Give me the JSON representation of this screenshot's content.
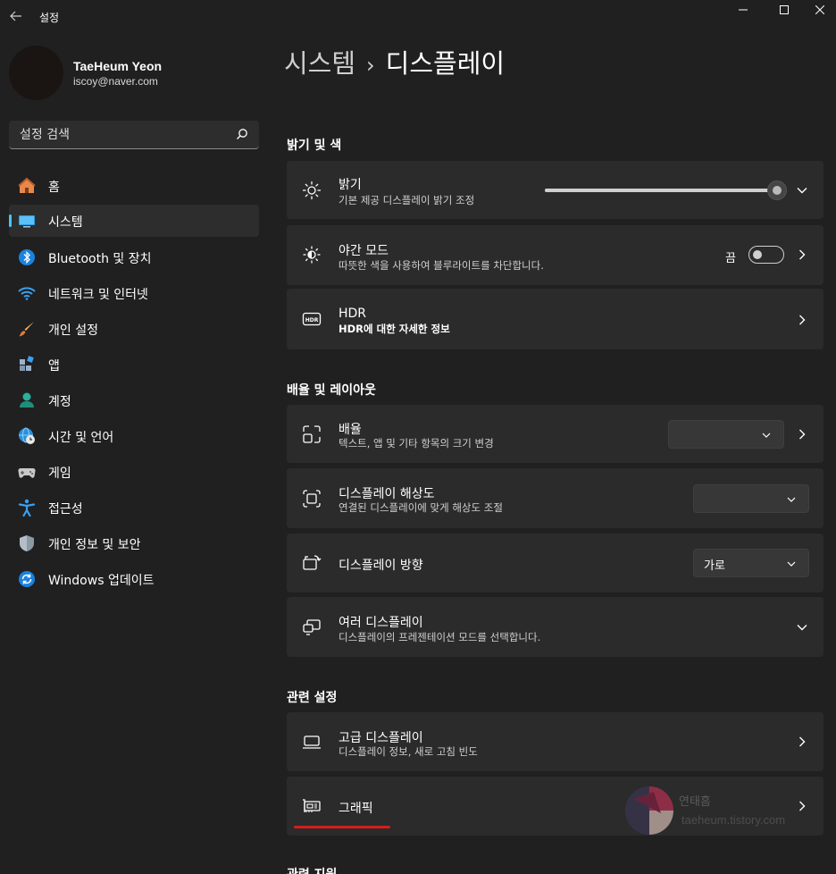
{
  "app": {
    "title": "설정"
  },
  "profile": {
    "name": "TaeHeum Yeon",
    "email": "iscoy@naver.com"
  },
  "search": {
    "placeholder": "설정 검색"
  },
  "nav": {
    "items": [
      {
        "label": "홈",
        "icon": "home-icon"
      },
      {
        "label": "시스템",
        "icon": "system-icon",
        "active": true
      },
      {
        "label": "Bluetooth 및 장치",
        "icon": "bluetooth-icon"
      },
      {
        "label": "네트워크 및 인터넷",
        "icon": "wifi-icon"
      },
      {
        "label": "개인 설정",
        "icon": "brush-icon"
      },
      {
        "label": "앱",
        "icon": "apps-icon"
      },
      {
        "label": "계정",
        "icon": "account-icon"
      },
      {
        "label": "시간 및 언어",
        "icon": "globe-clock-icon"
      },
      {
        "label": "게임",
        "icon": "gamepad-icon"
      },
      {
        "label": "접근성",
        "icon": "accessibility-icon"
      },
      {
        "label": "개인 정보 및 보안",
        "icon": "shield-icon"
      },
      {
        "label": "Windows 업데이트",
        "icon": "update-icon"
      }
    ]
  },
  "breadcrumb": {
    "parent": "시스템",
    "separator": "›",
    "current": "디스플레이"
  },
  "sections": {
    "brightness_color": "밝기 및 색",
    "scale_layout": "배율 및 레이아웃",
    "related_settings": "관련 설정",
    "related_support": "관련 지원"
  },
  "cards": {
    "brightness": {
      "title": "밝기",
      "desc": "기본 제공 디스플레이 밝기 조정",
      "level_percent": 100
    },
    "night_mode": {
      "title": "야간 모드",
      "desc": "따뜻한 색을 사용하여 블루라이트를 차단합니다.",
      "state_label": "끔"
    },
    "hdr": {
      "title": "HDR",
      "desc": "HDR에 대한 자세한 정보"
    },
    "scale": {
      "title": "배율",
      "desc": "텍스트, 앱 및 기타 항목의 크기 변경",
      "value": ""
    },
    "resolution": {
      "title": "디스플레이 해상도",
      "desc": " 연결된 디스플레이에 맞게 해상도 조절",
      "value": ""
    },
    "orientation": {
      "title": "디스플레이 방향",
      "value": "가로"
    },
    "multiple_displays": {
      "title": "여러 디스플레이",
      "desc": "디스플레이의 프레젠테이션 모드를 선택합니다."
    },
    "advanced_display": {
      "title": "고급 디스플레이",
      "desc": "디스플레이 정보, 새로 고침 빈도"
    },
    "graphics": {
      "title": "그래픽"
    }
  },
  "watermark": {
    "line1": "연태흠",
    "line2": "taeheum.tistory.com"
  },
  "colors": {
    "accent": "#4cc2ff",
    "background": "#202020",
    "card": "#2b2b2b",
    "highlight_underline": "#d51d1d"
  }
}
